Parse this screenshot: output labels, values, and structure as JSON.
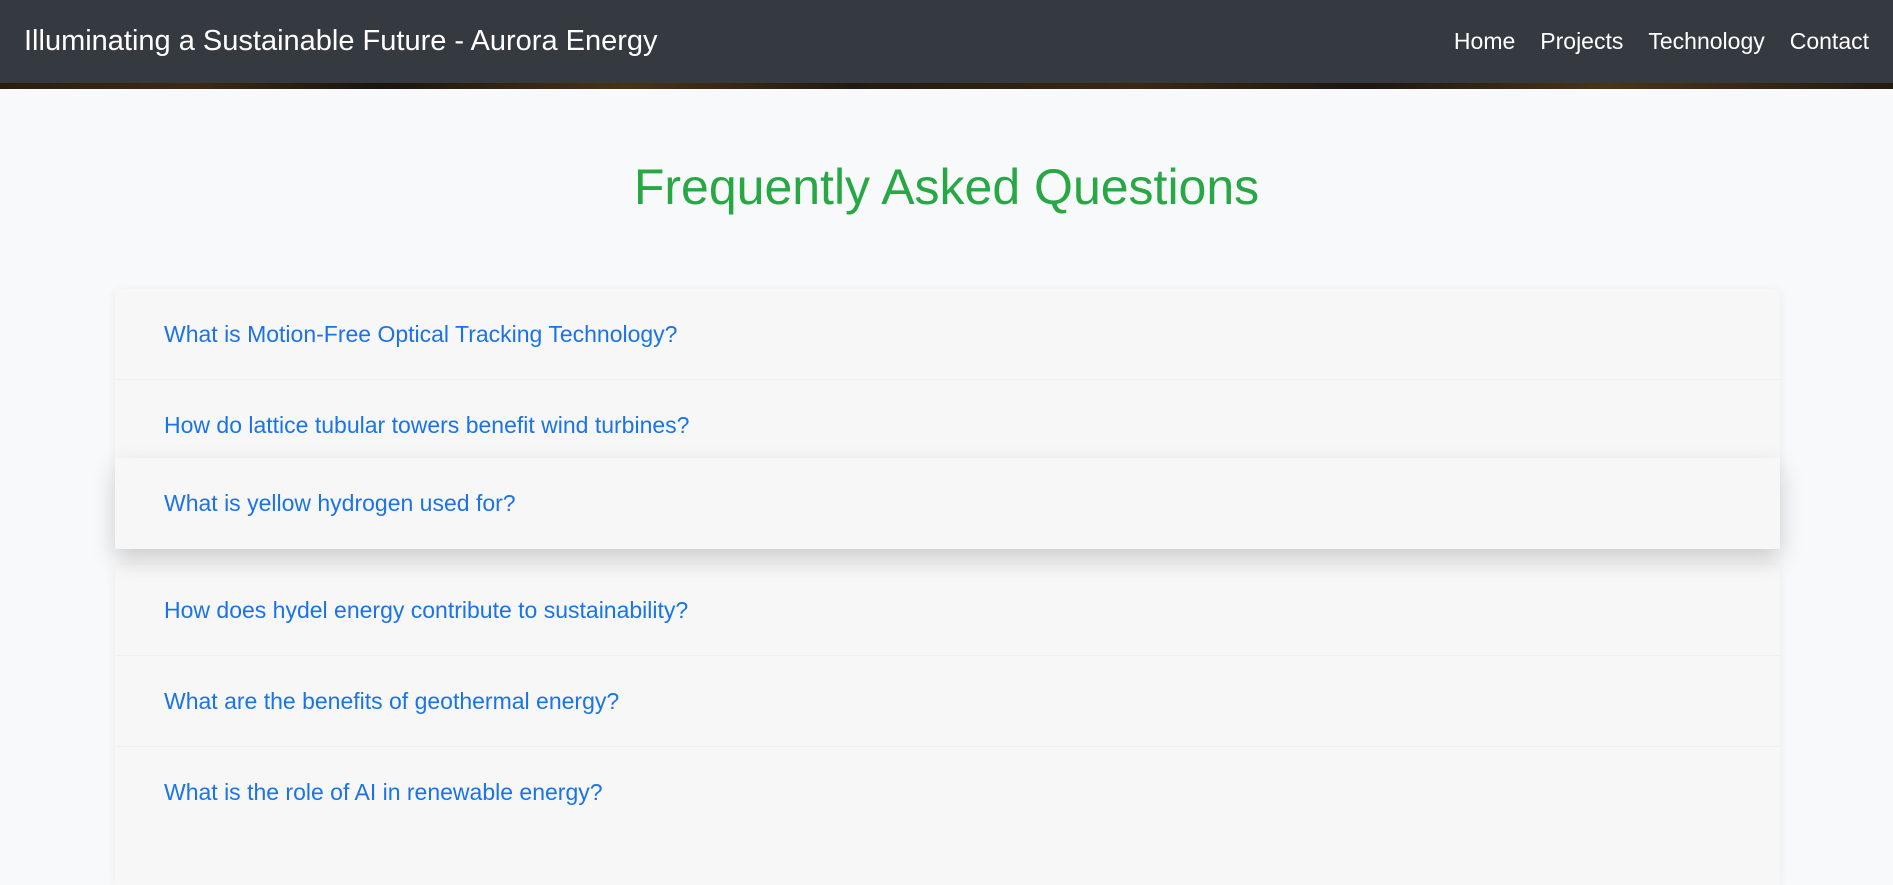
{
  "header": {
    "brand": "Illuminating a Sustainable Future - Aurora Energy",
    "nav": [
      "Home",
      "Projects",
      "Technology",
      "Contact"
    ]
  },
  "main": {
    "title": "Frequently Asked Questions",
    "faq": [
      "What is Motion-Free Optical Tracking Technology?",
      "How do lattice tubular towers benefit wind turbines?",
      "What is yellow hydrogen used for?",
      "How does hydel energy contribute to sustainability?",
      "What are the benefits of geothermal energy?",
      "What is the role of AI in renewable energy?"
    ]
  },
  "colors": {
    "navbar": "#343a40",
    "title": "#28a745",
    "question": "#1a73e8",
    "background": "#f8f9fa"
  }
}
